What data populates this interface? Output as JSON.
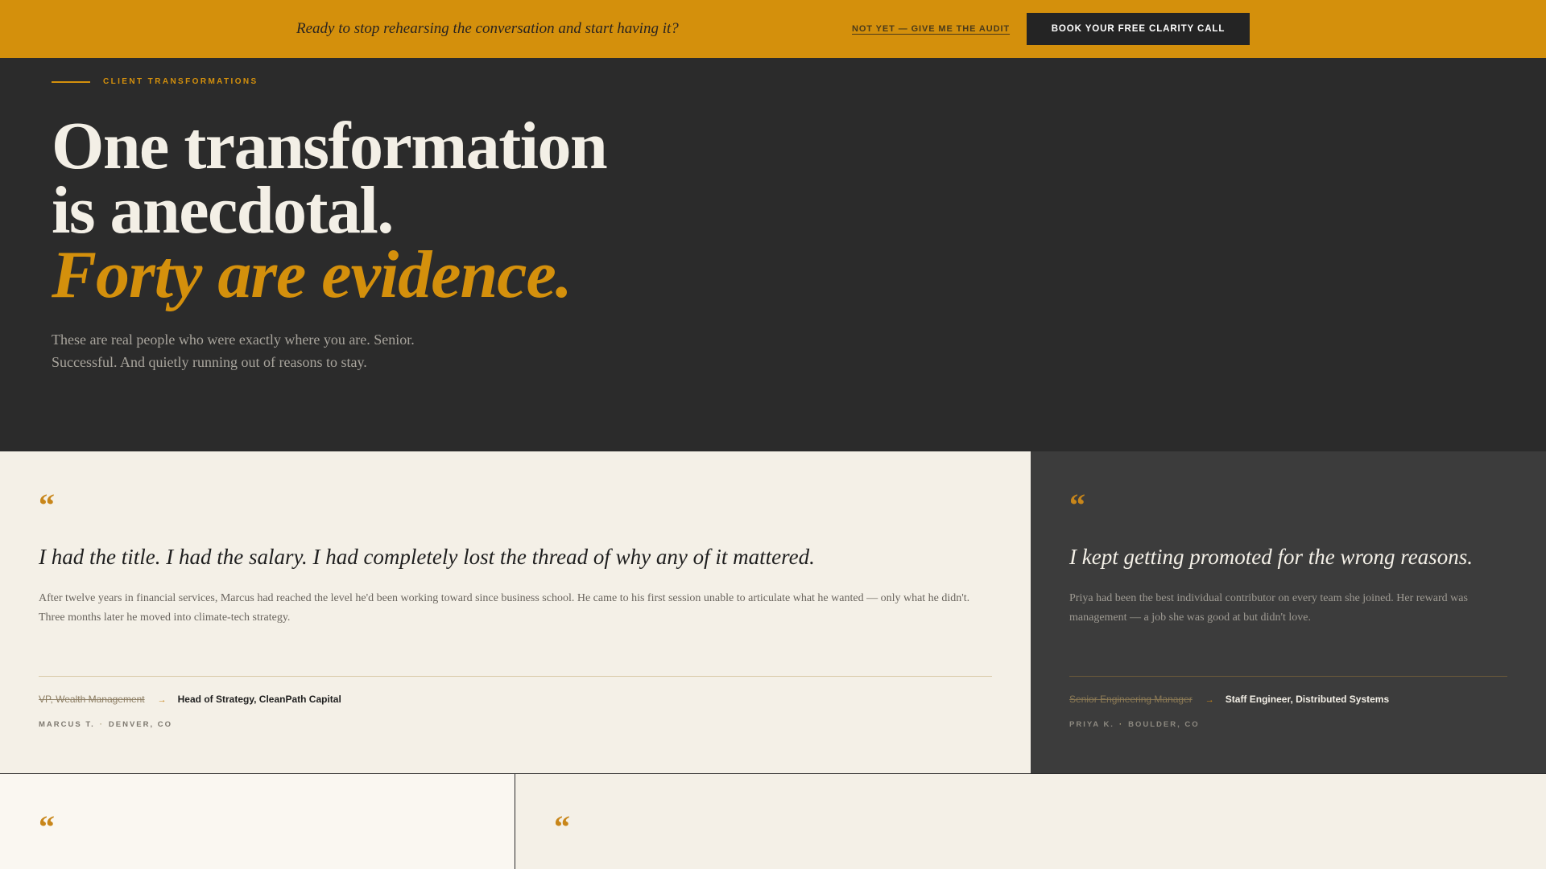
{
  "banner": {
    "text": "Ready to stop rehearsing the conversation and start having it?",
    "secondary_link": "NOT YET — GIVE ME THE AUDIT",
    "cta_button": "BOOK YOUR FREE CLARITY CALL",
    "background_color": "#d4900c"
  },
  "hero": {
    "eyebrow": "CLIENT TRANSFORMATIONS",
    "headline": {
      "line1": "One transformation",
      "line2": "is anecdotal.",
      "line3": "Forty are evidence."
    },
    "subtext": "These are real people who were exactly where you are. Senior. Successful. And quietly running out of reasons to stay."
  },
  "testimonials": [
    {
      "quote_mark": "“",
      "quote": "I had the title. I had the salary. I had completely lost the thread of why any of it mattered.",
      "story": "After twelve years in financial services, Marcus had reached the level he'd been working toward since business school. He came to his first session unable to articulate what he wanted — only what he didn't. Three months later he moved into climate-tech strategy.",
      "old_role": "VP, Wealth Management",
      "arrow": "→",
      "new_role": "Head of Strategy, CleanPath Capital",
      "name": "MARCUS T.",
      "separator": "·",
      "location": "DENVER, CO"
    },
    {
      "quote_mark": "“",
      "quote": "I kept getting promoted for the wrong reasons.",
      "story": "Priya had been the best individual contributor on every team she joined. Her reward was management — a job she was good at but didn't love.",
      "old_role": "Senior Engineering Manager",
      "arrow": "→",
      "new_role": "Staff Engineer, Distributed Systems",
      "name": "PRIYA K.",
      "separator": "·",
      "location": "BOULDER, CO"
    },
    {
      "quote_mark": "“"
    },
    {
      "quote_mark": "“"
    }
  ],
  "colors": {
    "accent": "#d4900c",
    "dark": "#2b2b2b",
    "cream": "#f4f0e7"
  }
}
